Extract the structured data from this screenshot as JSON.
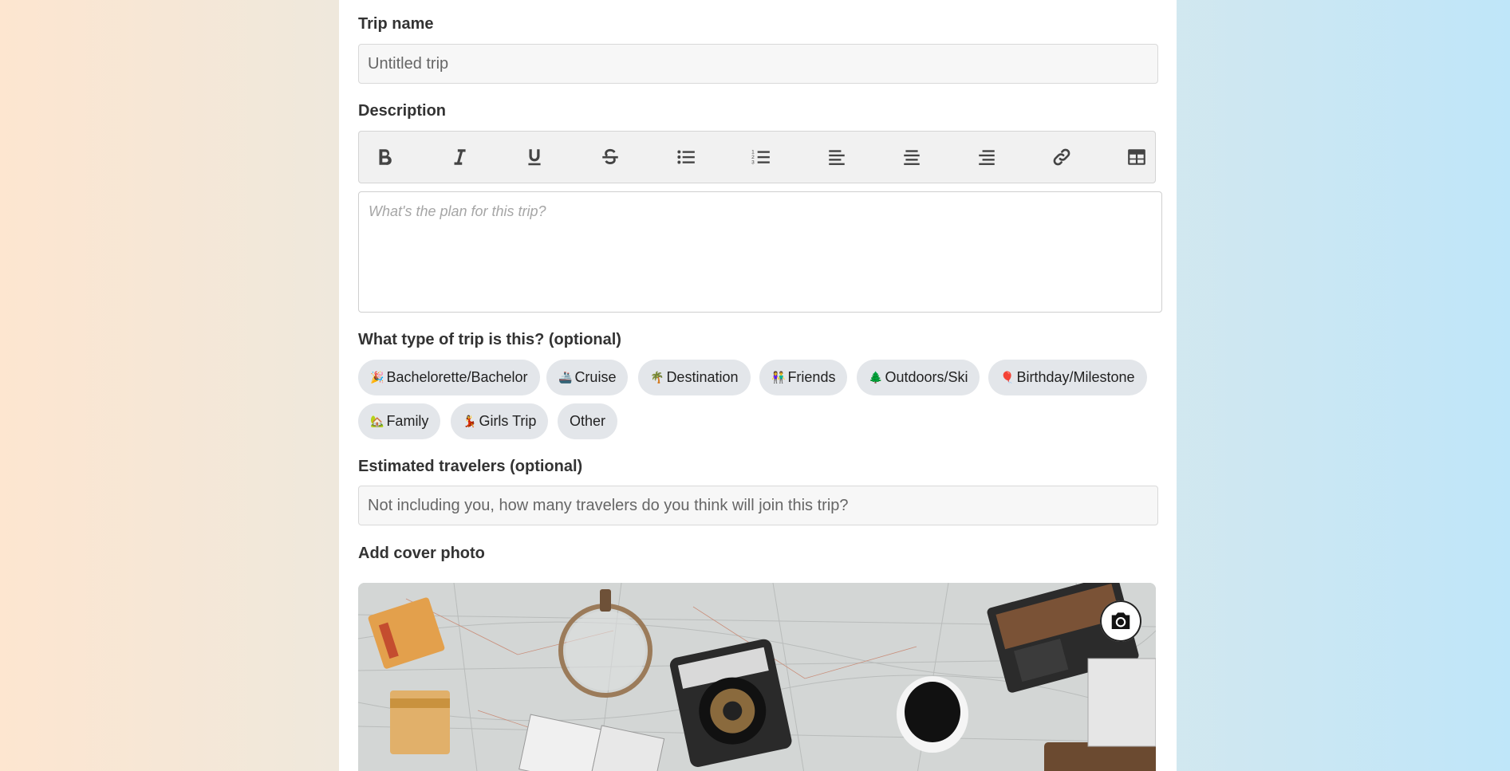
{
  "form": {
    "trip_name_label": "Trip name",
    "trip_name_placeholder": "Untitled trip",
    "trip_name_value": "",
    "description_label": "Description",
    "description_placeholder": "What's the plan for this trip?",
    "trip_type_label": "What type of trip is this? (optional)",
    "trip_types": [
      {
        "emoji": "🎉",
        "label": "Bachelorette/Bachelor"
      },
      {
        "emoji": "🚢",
        "label": "Cruise"
      },
      {
        "emoji": "🌴",
        "label": "Destination"
      },
      {
        "emoji": "👫",
        "label": "Friends"
      },
      {
        "emoji": "🌲",
        "label": "Outdoors/Ski"
      },
      {
        "emoji": "🎈",
        "label": "Birthday/Milestone"
      },
      {
        "emoji": "🏡",
        "label": "Family"
      },
      {
        "emoji": "💃",
        "label": "Girls Trip"
      },
      {
        "emoji": "",
        "label": "Other"
      }
    ],
    "travelers_label": "Estimated travelers (optional)",
    "travelers_placeholder": "Not including you, how many travelers do you think will join this trip?",
    "cover_photo_label": "Add cover photo"
  },
  "toolbar": {
    "buttons": [
      "bold-icon",
      "italic-icon",
      "underline-icon",
      "strikethrough-icon",
      "bullet-list-icon",
      "numbered-list-icon",
      "align-left-icon",
      "align-center-icon",
      "align-right-icon",
      "link-icon",
      "table-icon"
    ]
  },
  "colors": {
    "chip_bg": "#e3e6ea",
    "input_bg": "#f7f7f7",
    "toolbar_bg": "#f1f1f1"
  }
}
